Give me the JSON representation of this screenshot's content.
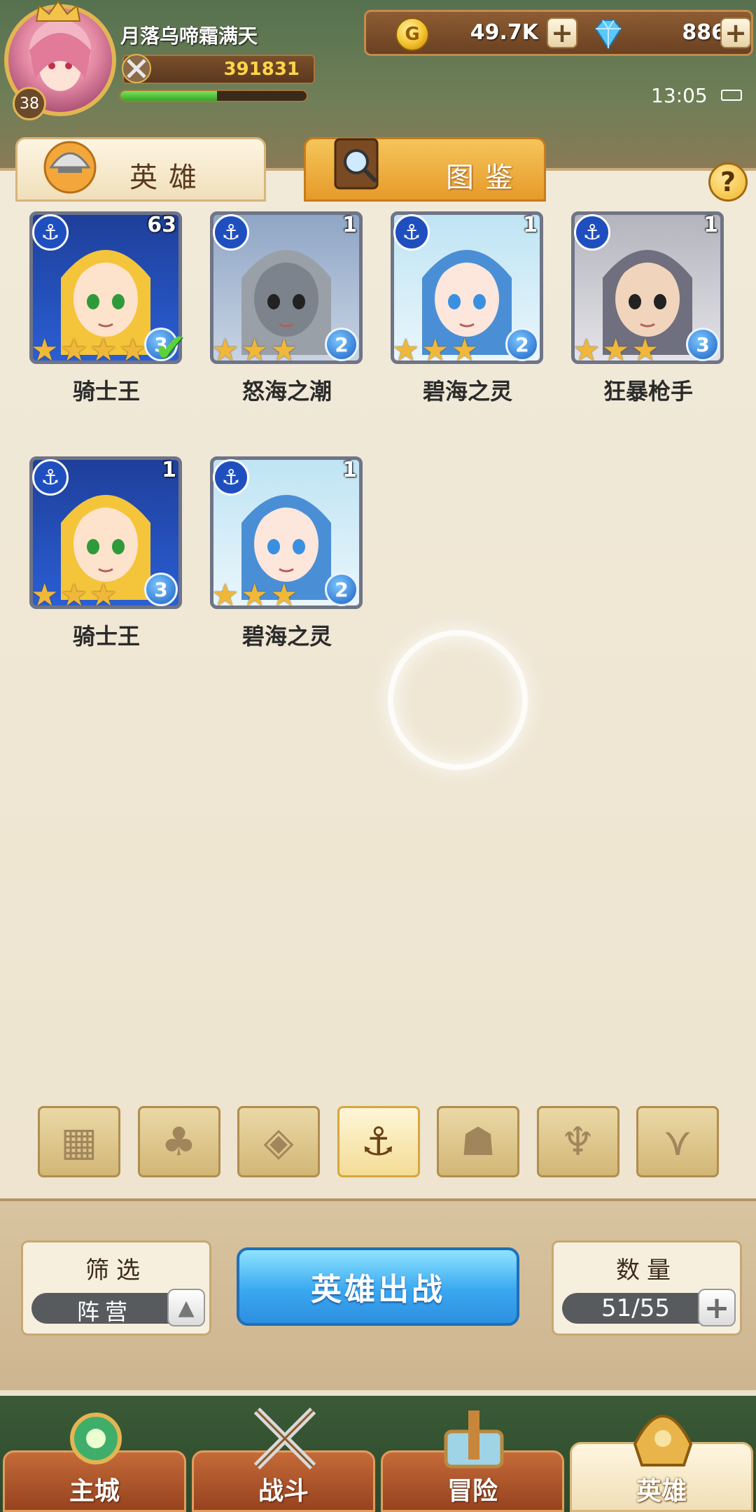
{
  "player": {
    "name": "月落乌啼霜满天",
    "level": "38",
    "power": "391831",
    "exp_fraction": 0.52
  },
  "resources": {
    "gold": "49.7K",
    "gems": "886",
    "coin_symbol": "G"
  },
  "status": {
    "time": "13:05"
  },
  "tabs": {
    "heroes": "英雄",
    "codex": "图鉴"
  },
  "help": "?",
  "heroes": [
    {
      "name": "骑士王",
      "level": "63",
      "stars": 4,
      "rank": "3",
      "selected": true,
      "portrait": "blonde-knight"
    },
    {
      "name": "怒海之潮",
      "level": "1",
      "stars": 3,
      "rank": "2",
      "selected": false,
      "portrait": "armored-knight"
    },
    {
      "name": "碧海之灵",
      "level": "1",
      "stars": 3,
      "rank": "2",
      "selected": false,
      "portrait": "blue-cat-girl"
    },
    {
      "name": "狂暴枪手",
      "level": "1",
      "stars": 3,
      "rank": "3",
      "selected": false,
      "portrait": "eyepatch-gunner"
    },
    {
      "name": "骑士王",
      "level": "1",
      "stars": 3,
      "rank": "3",
      "selected": false,
      "portrait": "blonde-knight"
    },
    {
      "name": "碧海之灵",
      "level": "1",
      "stars": 3,
      "rank": "2",
      "selected": false,
      "portrait": "blue-cat-girl"
    }
  ],
  "filters": [
    {
      "icon": "grid-icon",
      "active": false
    },
    {
      "icon": "leaf-faction-icon",
      "active": false
    },
    {
      "icon": "diamond-faction-icon",
      "active": false
    },
    {
      "icon": "anchor-faction-icon",
      "active": true
    },
    {
      "icon": "beast-faction-icon",
      "active": false
    },
    {
      "icon": "horned-faction-icon",
      "active": false
    },
    {
      "icon": "wing-faction-icon",
      "active": false
    }
  ],
  "bottom": {
    "filter_title": "筛选",
    "filter_value": "阵营",
    "deploy_label": "英雄出战",
    "count_title": "数量",
    "count_value": "51/55"
  },
  "nav": [
    {
      "label": "主城",
      "icon": "castle-icon",
      "active": false
    },
    {
      "label": "战斗",
      "icon": "crossed-swords-icon",
      "active": false
    },
    {
      "label": "冒险",
      "icon": "map-scroll-icon",
      "active": false
    },
    {
      "label": "英雄",
      "icon": "helmet-icon",
      "active": true
    }
  ],
  "colors": {
    "panel": "#efe6d2",
    "accent_orange": "#e79a2a",
    "deploy_blue": "#3aa8f0",
    "star_gold": "#f0b83a"
  }
}
